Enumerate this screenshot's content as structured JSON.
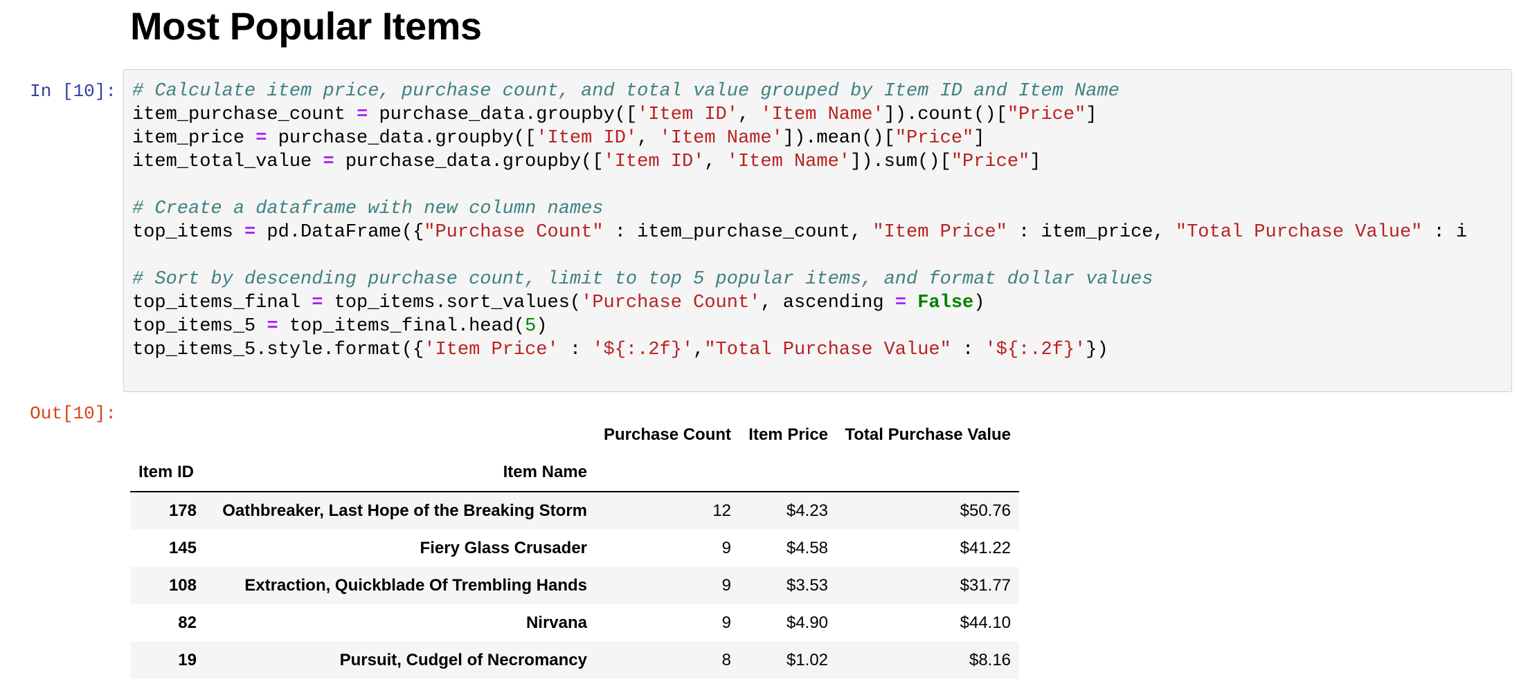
{
  "page": {
    "heading": "Most Popular Items"
  },
  "input_cell": {
    "prompt": "In [10]:",
    "code_lines": [
      [
        {
          "t": "comment",
          "v": "# Calculate item price, purchase count, and total value grouped by Item ID and Item Name"
        }
      ],
      [
        {
          "t": "plain",
          "v": "item_purchase_count "
        },
        {
          "t": "op",
          "v": "="
        },
        {
          "t": "plain",
          "v": " purchase_data.groupby(["
        },
        {
          "t": "str",
          "v": "'Item ID'"
        },
        {
          "t": "plain",
          "v": ", "
        },
        {
          "t": "str",
          "v": "'Item Name'"
        },
        {
          "t": "plain",
          "v": "]).count()["
        },
        {
          "t": "str",
          "v": "\"Price\""
        },
        {
          "t": "plain",
          "v": "]"
        }
      ],
      [
        {
          "t": "plain",
          "v": "item_price "
        },
        {
          "t": "op",
          "v": "="
        },
        {
          "t": "plain",
          "v": " purchase_data.groupby(["
        },
        {
          "t": "str",
          "v": "'Item ID'"
        },
        {
          "t": "plain",
          "v": ", "
        },
        {
          "t": "str",
          "v": "'Item Name'"
        },
        {
          "t": "plain",
          "v": "]).mean()["
        },
        {
          "t": "str",
          "v": "\"Price\""
        },
        {
          "t": "plain",
          "v": "]"
        }
      ],
      [
        {
          "t": "plain",
          "v": "item_total_value "
        },
        {
          "t": "op",
          "v": "="
        },
        {
          "t": "plain",
          "v": " purchase_data.groupby(["
        },
        {
          "t": "str",
          "v": "'Item ID'"
        },
        {
          "t": "plain",
          "v": ", "
        },
        {
          "t": "str",
          "v": "'Item Name'"
        },
        {
          "t": "plain",
          "v": "]).sum()["
        },
        {
          "t": "str",
          "v": "\"Price\""
        },
        {
          "t": "plain",
          "v": "]"
        }
      ],
      [],
      [
        {
          "t": "comment",
          "v": "# Create a dataframe with new column names"
        }
      ],
      [
        {
          "t": "plain",
          "v": "top_items "
        },
        {
          "t": "op",
          "v": "="
        },
        {
          "t": "plain",
          "v": " pd.DataFrame({"
        },
        {
          "t": "str",
          "v": "\"Purchase Count\""
        },
        {
          "t": "plain",
          "v": " : item_purchase_count, "
        },
        {
          "t": "str",
          "v": "\"Item Price\""
        },
        {
          "t": "plain",
          "v": " : item_price, "
        },
        {
          "t": "str",
          "v": "\"Total Purchase Value\""
        },
        {
          "t": "plain",
          "v": " : i"
        }
      ],
      [],
      [
        {
          "t": "comment",
          "v": "# Sort by descending purchase count, limit to top 5 popular items, and format dollar values"
        }
      ],
      [
        {
          "t": "plain",
          "v": "top_items_final "
        },
        {
          "t": "op",
          "v": "="
        },
        {
          "t": "plain",
          "v": " top_items.sort_values("
        },
        {
          "t": "str",
          "v": "'Purchase Count'"
        },
        {
          "t": "plain",
          "v": ", ascending "
        },
        {
          "t": "op",
          "v": "="
        },
        {
          "t": "plain",
          "v": " "
        },
        {
          "t": "kw",
          "v": "False"
        },
        {
          "t": "plain",
          "v": ")"
        }
      ],
      [
        {
          "t": "plain",
          "v": "top_items_5 "
        },
        {
          "t": "op",
          "v": "="
        },
        {
          "t": "plain",
          "v": " top_items_final.head("
        },
        {
          "t": "num",
          "v": "5"
        },
        {
          "t": "plain",
          "v": ")"
        }
      ],
      [
        {
          "t": "plain",
          "v": "top_items_5.style.format({"
        },
        {
          "t": "str",
          "v": "'Item Price'"
        },
        {
          "t": "plain",
          "v": " : "
        },
        {
          "t": "str",
          "v": "'${:.2f}'"
        },
        {
          "t": "plain",
          "v": ","
        },
        {
          "t": "str",
          "v": "\"Total Purchase Value\""
        },
        {
          "t": "plain",
          "v": " : "
        },
        {
          "t": "str",
          "v": "'${:.2f}'"
        },
        {
          "t": "plain",
          "v": "})"
        }
      ]
    ]
  },
  "output_cell": {
    "prompt": "Out[10]:",
    "table": {
      "column_headers": [
        "Purchase Count",
        "Item Price",
        "Total Purchase Value"
      ],
      "index_names": [
        "Item ID",
        "Item Name"
      ],
      "rows": [
        {
          "item_id": "178",
          "item_name": "Oathbreaker, Last Hope of the Breaking Storm",
          "purchase_count": "12",
          "item_price": "$4.23",
          "total_value": "$50.76"
        },
        {
          "item_id": "145",
          "item_name": "Fiery Glass Crusader",
          "purchase_count": "9",
          "item_price": "$4.58",
          "total_value": "$41.22"
        },
        {
          "item_id": "108",
          "item_name": "Extraction, Quickblade Of Trembling Hands",
          "purchase_count": "9",
          "item_price": "$3.53",
          "total_value": "$31.77"
        },
        {
          "item_id": "82",
          "item_name": "Nirvana",
          "purchase_count": "9",
          "item_price": "$4.90",
          "total_value": "$44.10"
        },
        {
          "item_id": "19",
          "item_name": "Pursuit, Cudgel of Necromancy",
          "purchase_count": "8",
          "item_price": "$1.02",
          "total_value": "$8.16"
        }
      ]
    }
  }
}
